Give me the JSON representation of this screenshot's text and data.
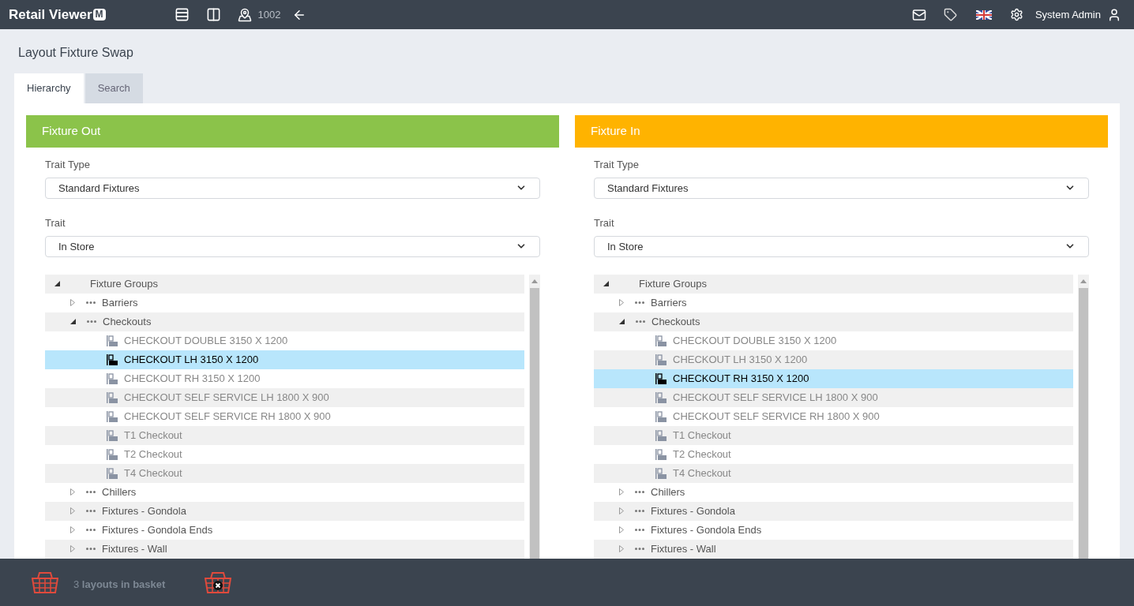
{
  "header": {
    "brand": "Retail Viewer",
    "brand_mark": "M",
    "store_number": "1002",
    "user": "System Admin"
  },
  "page_title": "Layout Fixture Swap",
  "tabs": [
    {
      "label": "Hierarchy",
      "selected": true
    },
    {
      "label": "Search",
      "selected": false
    }
  ],
  "panels": [
    {
      "title": "Fixture Out",
      "color": "#8bc34a",
      "trait_type_label": "Trait Type",
      "trait_type": "Standard Fixtures",
      "trait_label": "Trait",
      "trait": "In Store",
      "tree": {
        "label": "Fixture Groups",
        "expanded": true,
        "children": [
          {
            "label": "Barriers",
            "expanded": false
          },
          {
            "label": "Checkouts",
            "expanded": true,
            "children": [
              {
                "label": "CHECKOUT DOUBLE 3150 X 1200",
                "selected": false
              },
              {
                "label": "CHECKOUT LH 3150 X 1200",
                "selected": true
              },
              {
                "label": "CHECKOUT RH 3150 X 1200",
                "selected": false
              },
              {
                "label": "CHECKOUT SELF SERVICE LH 1800 X 900",
                "selected": false
              },
              {
                "label": "CHECKOUT SELF SERVICE RH 1800 X 900",
                "selected": false
              },
              {
                "label": "T1 Checkout",
                "selected": false
              },
              {
                "label": "T2 Checkout",
                "selected": false
              },
              {
                "label": "T4 Checkout",
                "selected": false
              }
            ]
          },
          {
            "label": "Chillers",
            "expanded": false
          },
          {
            "label": "Fixtures - Gondola",
            "expanded": false
          },
          {
            "label": "Fixtures - Gondola Ends",
            "expanded": false
          },
          {
            "label": "Fixtures - Wall",
            "expanded": false
          }
        ]
      }
    },
    {
      "title": "Fixture In",
      "color": "#ffb300",
      "trait_type_label": "Trait Type",
      "trait_type": "Standard Fixtures",
      "trait_label": "Trait",
      "trait": "In Store",
      "tree": {
        "label": "Fixture Groups",
        "expanded": true,
        "children": [
          {
            "label": "Barriers",
            "expanded": false
          },
          {
            "label": "Checkouts",
            "expanded": true,
            "children": [
              {
                "label": "CHECKOUT DOUBLE 3150 X 1200",
                "selected": false
              },
              {
                "label": "CHECKOUT LH 3150 X 1200",
                "selected": false
              },
              {
                "label": "CHECKOUT RH 3150 X 1200",
                "selected": true
              },
              {
                "label": "CHECKOUT SELF SERVICE LH 1800 X 900",
                "selected": false
              },
              {
                "label": "CHECKOUT SELF SERVICE RH 1800 X 900",
                "selected": false
              },
              {
                "label": "T1 Checkout",
                "selected": false
              },
              {
                "label": "T2 Checkout",
                "selected": false
              },
              {
                "label": "T4 Checkout",
                "selected": false
              }
            ]
          },
          {
            "label": "Chillers",
            "expanded": false
          },
          {
            "label": "Fixtures - Gondola",
            "expanded": false
          },
          {
            "label": "Fixtures - Gondola Ends",
            "expanded": false
          },
          {
            "label": "Fixtures - Wall",
            "expanded": false
          }
        ]
      }
    }
  ],
  "basket": {
    "count": "3",
    "text": "layouts in basket"
  }
}
